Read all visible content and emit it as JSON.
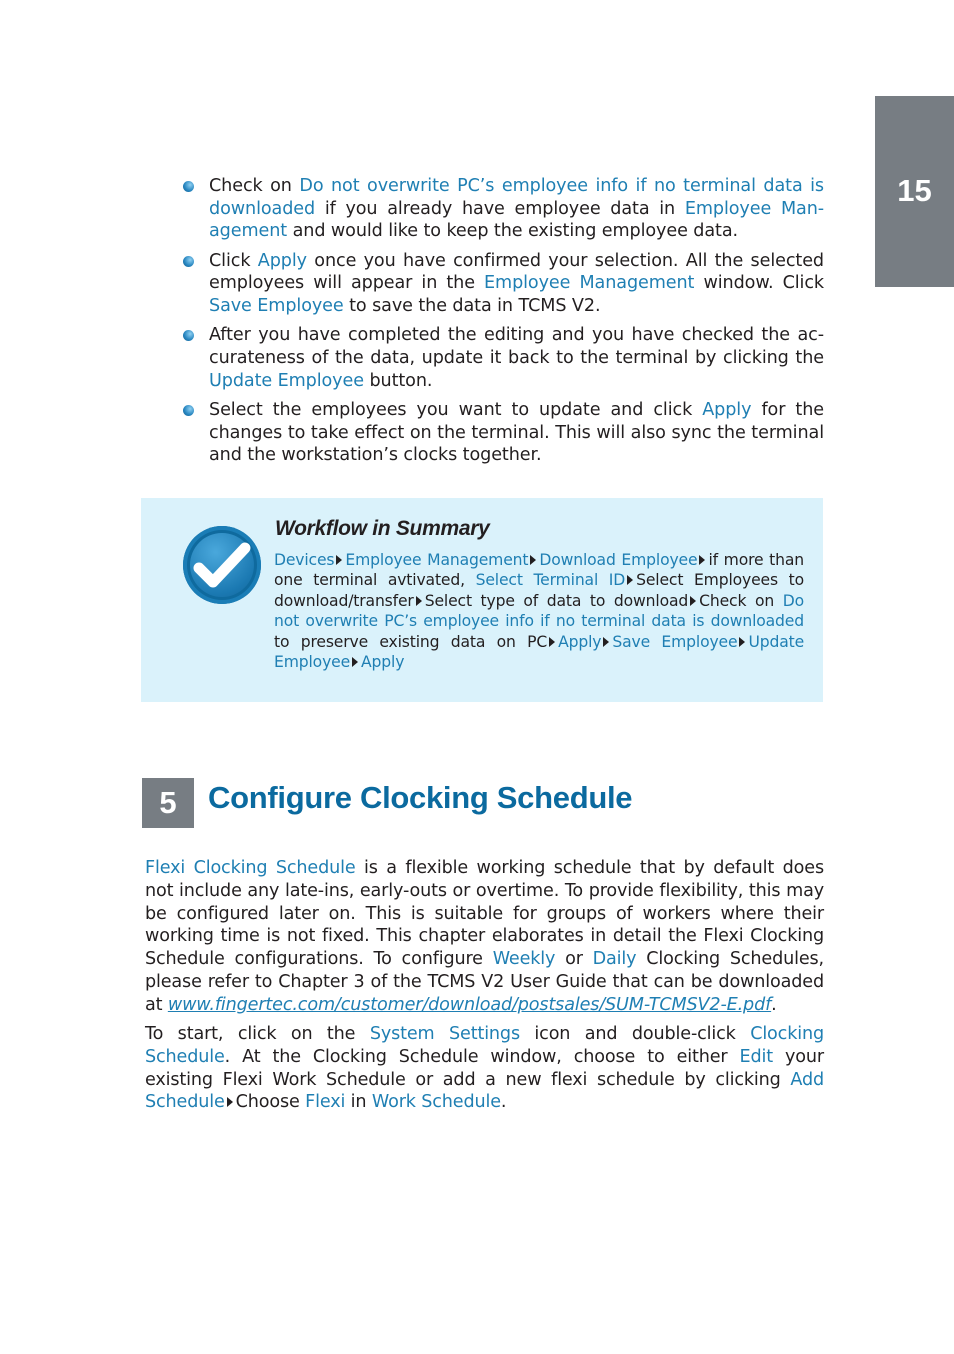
{
  "page_number": "15",
  "bullets": [
    [
      {
        "t": "Check on "
      },
      {
        "t": "Do not overwrite PC’s employee info if no terminal data is downloaded",
        "hl": true
      },
      {
        "t": " if you already have employee data in "
      },
      {
        "t": "Employee Man-agement",
        "hl": true
      },
      {
        "t": " and would like to keep the existing employee data."
      }
    ],
    [
      {
        "t": "Click "
      },
      {
        "t": "Apply",
        "hl": true
      },
      {
        "t": " once you have confirmed your selection. All the selected employees will appear in the "
      },
      {
        "t": "Employee Management",
        "hl": true
      },
      {
        "t": " window. Click "
      },
      {
        "t": "Save Employee",
        "hl": true
      },
      {
        "t": " to save the data in TCMS V2."
      }
    ],
    [
      {
        "t": "After you have completed the editing and you have checked the ac-curateness of the data, update it back to the terminal by clicking the "
      },
      {
        "t": "Update Employee",
        "hl": true
      },
      {
        "t": " button."
      }
    ],
    [
      {
        "t": "Select the employees you want to update and click "
      },
      {
        "t": "Apply",
        "hl": true
      },
      {
        "t": " for the changes to take effect on the terminal. This will also sync the terminal and the workstation’s clocks together."
      }
    ]
  ],
  "summary": {
    "title": "Workflow in Summary",
    "icon": "checkmark-icon",
    "steps": [
      {
        "t": "Devices",
        "hl": true
      },
      {
        "t": "Employee Management",
        "hl": true
      },
      {
        "t": "Download Employee",
        "hl": true
      },
      {
        "parts": [
          {
            "t": "if more than one terminal avtivated, "
          },
          {
            "t": "Select Terminal ID",
            "hl": true
          }
        ]
      },
      {
        "t": "Select Employees to download/transfer"
      },
      {
        "t": "Select type of data to download"
      },
      {
        "parts": [
          {
            "t": "Check on "
          },
          {
            "t": "Do not overwrite PC’s employee info if no terminal data is downloaded",
            "hl": true
          },
          {
            "t": " to preserve existing data on PC"
          }
        ]
      },
      {
        "t": "Apply",
        "hl": true
      },
      {
        "t": "Save Employee",
        "hl": true
      },
      {
        "t": "Update Employee",
        "hl": true
      },
      {
        "t": "Apply",
        "hl": true
      }
    ]
  },
  "section": {
    "number": "5",
    "title": "Configure Clocking Schedule"
  },
  "paragraphs": [
    [
      {
        "t": "Flexi Clocking Schedule",
        "hl": true
      },
      {
        "t": " is a flexible working schedule that by default does not include any late-ins, early-outs or overtime. To provide flexibility, this may be configured later on. This is suitable for groups of workers where their working time is not fixed. This chapter elaborates in detail the Flexi Clocking Schedule configurations. To configure "
      },
      {
        "t": "Weekly",
        "hl": true
      },
      {
        "t": " or "
      },
      {
        "t": "Daily",
        "hl": true
      },
      {
        "t": " Clocking Schedules, please refer to Chapter 3 of the TCMS V2 User Guide that can be downloaded at "
      },
      {
        "t": "www.fingertec.com/customer/download/postsales/SUM-TCMSV2-E.pdf",
        "link": true
      },
      {
        "t": "."
      }
    ],
    [
      {
        "t": "To start, click on the "
      },
      {
        "t": "System Settings",
        "hl": true
      },
      {
        "t": " icon and double-click "
      },
      {
        "t": "Clocking Schedule",
        "hl": true
      },
      {
        "t": ". At the Clocking Schedule window, choose to either "
      },
      {
        "t": "Edit",
        "hl": true
      },
      {
        "t": " your existing Flexi Work Schedule or add a new flexi schedule by clicking "
      },
      {
        "t": "Add Schedule",
        "hl": true
      },
      {
        "arrow": true
      },
      {
        "t": "Choose "
      },
      {
        "t": "Flexi",
        "hl": true
      },
      {
        "t": " in "
      },
      {
        "t": "Work Schedule",
        "hl": true
      },
      {
        "t": "."
      }
    ]
  ]
}
